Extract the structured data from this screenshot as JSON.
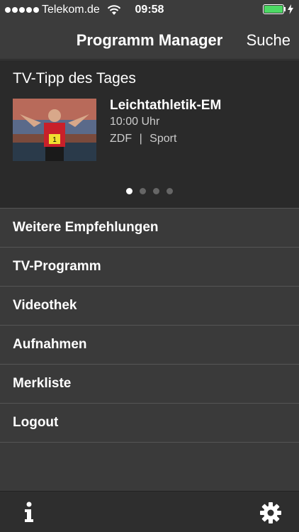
{
  "statusbar": {
    "carrier": "Telekom.de",
    "time": "09:58"
  },
  "navbar": {
    "title": "Programm Manager",
    "search_label": "Suche"
  },
  "tip": {
    "heading": "TV-Tipp des Tages",
    "show_title": "Leichtathletik-EM",
    "time": "10:00 Uhr",
    "channel": "ZDF",
    "separator": "|",
    "genre": "Sport",
    "page_count": 4,
    "active_page": 1
  },
  "menu": {
    "items": [
      {
        "label": "Weitere Empfehlungen"
      },
      {
        "label": "TV-Programm"
      },
      {
        "label": "Videothek"
      },
      {
        "label": "Aufnahmen"
      },
      {
        "label": "Merkliste"
      },
      {
        "label": "Logout"
      }
    ]
  },
  "colors": {
    "battery": "#4cd964",
    "background": "#3a3a3a",
    "panel": "#2a2a2a"
  },
  "icons": {
    "info": "info-icon",
    "settings": "gear-icon"
  }
}
